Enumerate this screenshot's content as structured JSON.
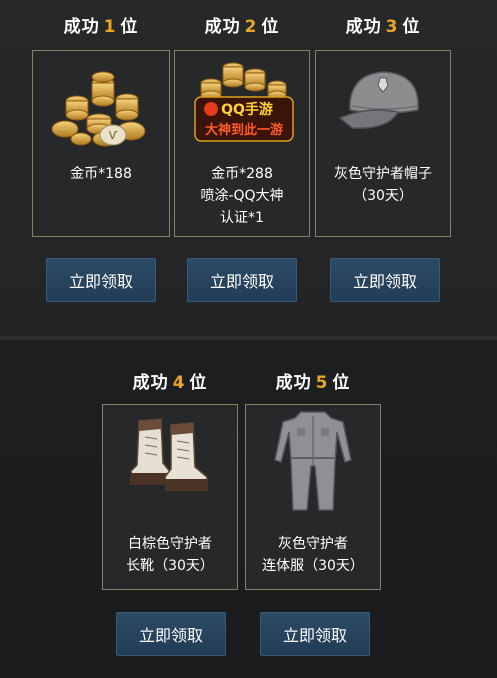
{
  "ranks": [
    {
      "prefix": "成功",
      "num": "1",
      "suffix": "位"
    },
    {
      "prefix": "成功",
      "num": "2",
      "suffix": "位"
    },
    {
      "prefix": "成功",
      "num": "3",
      "suffix": "位"
    },
    {
      "prefix": "成功",
      "num": "4",
      "suffix": "位"
    },
    {
      "prefix": "成功",
      "num": "5",
      "suffix": "位"
    }
  ],
  "rewards": [
    {
      "lines": [
        "金币*188"
      ],
      "icon": "gold-coins-icon"
    },
    {
      "lines": [
        "金币*288",
        "喷涂-QQ大神",
        "认证*1"
      ],
      "icon": "gold-coins-qq-badge-icon",
      "badge_line1": "QQ手游",
      "badge_line2": "大神到此一游"
    },
    {
      "lines": [
        "灰色守护者帽子",
        "（30天）"
      ],
      "icon": "gray-cap-icon"
    },
    {
      "lines": [
        "白棕色守护者",
        "长靴（30天）"
      ],
      "icon": "boots-icon"
    },
    {
      "lines": [
        "灰色守护者",
        "连体服（30天）"
      ],
      "icon": "jumpsuit-icon"
    }
  ],
  "claim_label": "立即领取",
  "colors": {
    "rank_number": "#e8a628",
    "card_border": "#8a7f62",
    "button": "#2d4b66"
  }
}
